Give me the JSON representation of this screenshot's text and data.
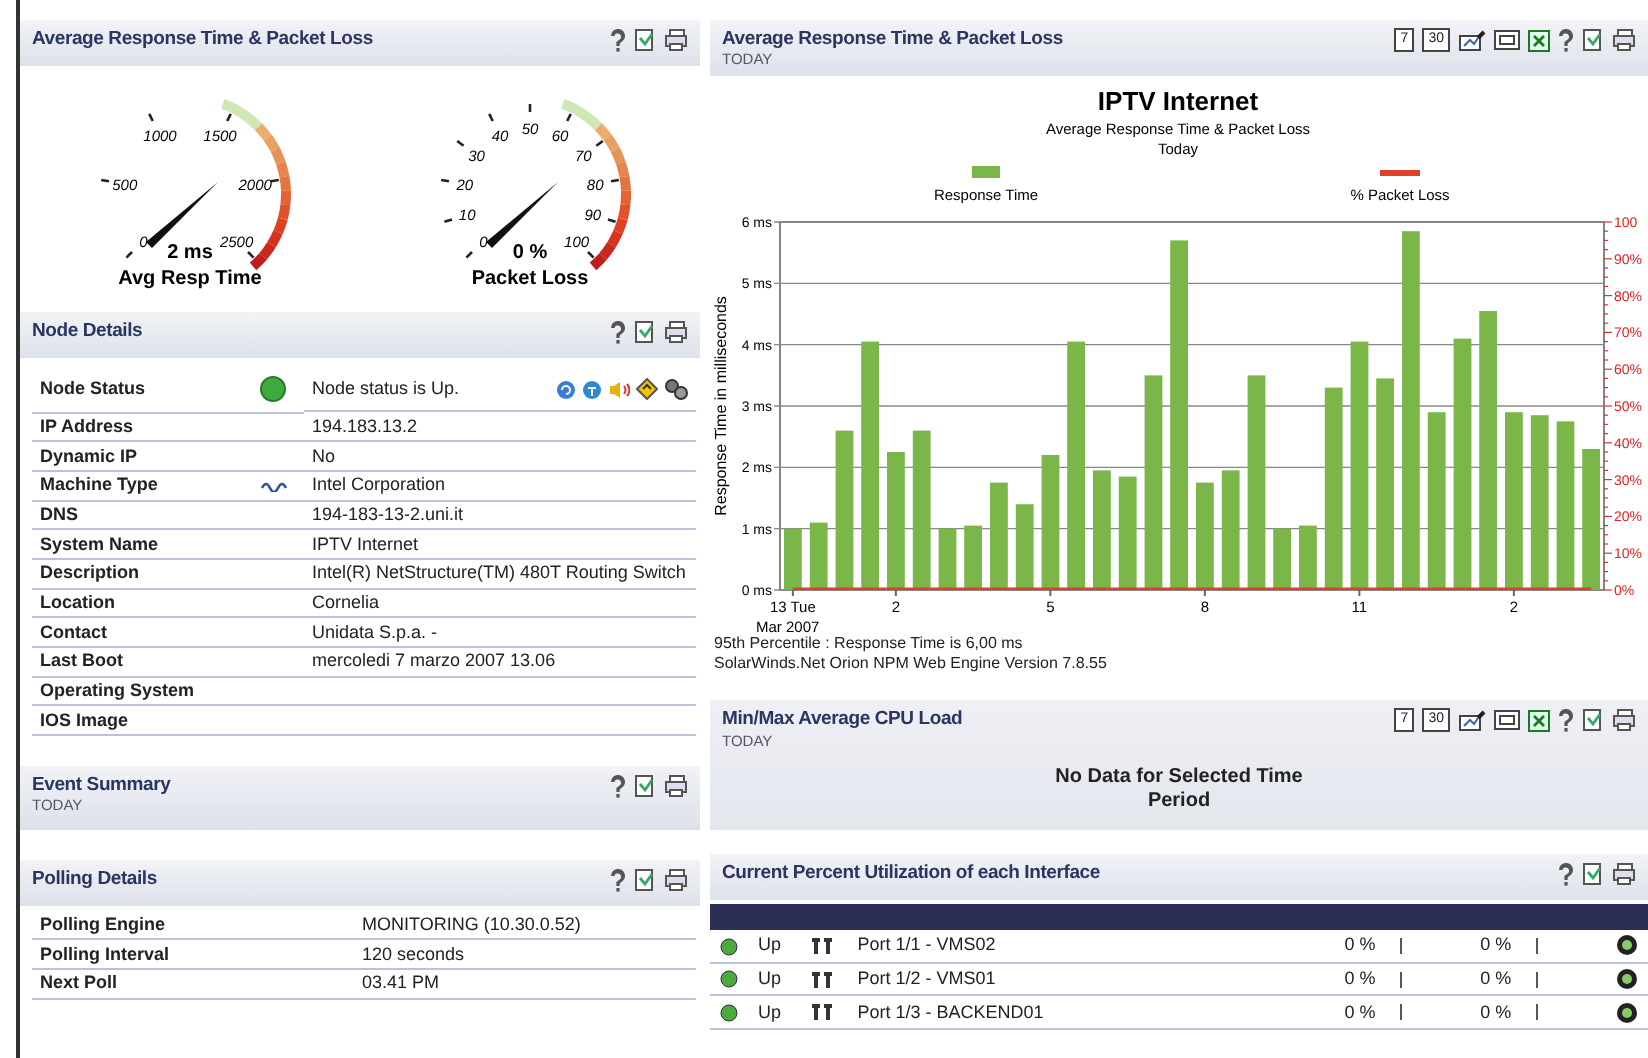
{
  "gauges_panel": {
    "title": "Average Response Time & Packet Loss",
    "gauges": [
      {
        "scale": [
          "0",
          "500",
          "1000",
          "1500",
          "2000",
          "2500"
        ],
        "reading": "2 ms",
        "label": "Avg Resp Time"
      },
      {
        "scale": [
          "0",
          "10",
          "20",
          "30",
          "40",
          "50",
          "60",
          "70",
          "80",
          "90",
          "100"
        ],
        "reading": "0 %",
        "label": "Packet Loss"
      }
    ]
  },
  "node_details": {
    "title": "Node Details",
    "rows": [
      {
        "label": "Node Status",
        "kind": "status",
        "value": "Node status is Up."
      },
      {
        "label": "IP Address",
        "value": "194.183.13.2"
      },
      {
        "label": "Dynamic IP",
        "value": "No"
      },
      {
        "label": "Machine Type",
        "kind": "vendor",
        "value": "Intel Corporation"
      },
      {
        "label": "DNS",
        "value": "194-183-13-2.uni.it"
      },
      {
        "label": "System Name",
        "value": "IPTV Internet"
      },
      {
        "label": "Description",
        "value": "Intel(R) NetStructure(TM) 480T Routing Switch"
      },
      {
        "label": "Location",
        "value": "Cornelia"
      },
      {
        "label": "Contact",
        "value": "Unidata S.p.a. -"
      },
      {
        "label": "Last Boot",
        "value": "mercoledi 7 marzo 2007 13.06"
      },
      {
        "label": "Operating System"
      },
      {
        "label": "IOS Image"
      }
    ]
  },
  "event_summary": {
    "title": "Event Summary",
    "period": "TODAY"
  },
  "polling_details": {
    "title": "Polling Details",
    "rows": [
      {
        "label": "Polling Engine",
        "value": "MONITORING (10.30.0.52)"
      },
      {
        "label": "Polling Interval",
        "value": "120 seconds"
      },
      {
        "label": "Next Poll",
        "value": "03.41 PM"
      }
    ]
  },
  "chart_panel": {
    "title": "Average Response Time & Packet Loss",
    "period": "TODAY",
    "toolbar": [
      "7",
      "30"
    ],
    "subtitle": "Average Response Time & Packet Loss",
    "range": "Today",
    "date_label": "Mar 2007",
    "notes": [
      "95th Percentile : Response Time is 6,00 ms",
      "SolarWinds.Net Orion NPM Web Engine  Version 7.8.55"
    ],
    "chart_data": {
      "type": "bar",
      "title": "IPTV Internet",
      "ylabel": "Response Time in milliseconds",
      "categories": [
        "13 Tue",
        null,
        null,
        null,
        "2",
        null,
        null,
        null,
        null,
        null,
        "5",
        null,
        null,
        null,
        null,
        null,
        "8",
        null,
        null,
        null,
        null,
        null,
        "11",
        null,
        null,
        null,
        null,
        null,
        "2",
        null,
        null,
        null
      ],
      "y2lim": [
        0,
        100
      ],
      "grid": true,
      "ylim": [
        0,
        6
      ],
      "yticks": [
        {
          "value": 0,
          "label": "0 ms"
        },
        {
          "value": 1,
          "label": "1 ms"
        },
        {
          "value": 2,
          "label": "2 ms"
        },
        {
          "value": 3,
          "label": "3 ms"
        },
        {
          "value": 4,
          "label": "4 ms"
        },
        {
          "value": 5,
          "label": "5 ms"
        },
        {
          "value": 6,
          "label": "6 ms"
        }
      ],
      "y2ticks": [
        {
          "value": 0,
          "label": "0%"
        },
        {
          "value": 10,
          "label": "10%"
        },
        {
          "value": 20,
          "label": "20%"
        },
        {
          "value": 30,
          "label": "30%"
        },
        {
          "value": 40,
          "label": "40%"
        },
        {
          "value": 50,
          "label": "50%"
        },
        {
          "value": 60,
          "label": "60%"
        },
        {
          "value": 70,
          "label": "70%"
        },
        {
          "value": 80,
          "label": "80%"
        },
        {
          "value": 90,
          "label": "90%"
        },
        {
          "value": 100,
          "label": "100"
        }
      ],
      "series": [
        {
          "name": "Response Time",
          "color": "#7ab648",
          "values": [
            1.0,
            1.1,
            2.6,
            4.05,
            2.25,
            2.6,
            1.0,
            1.05,
            1.75,
            1.4,
            2.2,
            4.05,
            1.95,
            1.85,
            3.5,
            5.7,
            1.75,
            1.95,
            3.5,
            1.0,
            1.05,
            3.3,
            4.05,
            3.45,
            5.85,
            2.9,
            4.1,
            4.55,
            2.9,
            2.85,
            2.75,
            2.3
          ]
        },
        {
          "name": "% Packet Loss",
          "color": "#e04028",
          "values": [
            0,
            0,
            0,
            0,
            0,
            0,
            0,
            0,
            0,
            0,
            0,
            0,
            0,
            0,
            0,
            0,
            0,
            0,
            0,
            0,
            0,
            0,
            0,
            0,
            0,
            0,
            0,
            0,
            0,
            0,
            0,
            0
          ]
        }
      ]
    }
  },
  "cpu_panel": {
    "title": "Min/Max Average CPU Load",
    "period": "TODAY",
    "toolbar": [
      "7",
      "30"
    ],
    "message": "No Data for Selected Time Period"
  },
  "interfaces_panel": {
    "title": "Current Percent Utilization of each Interface",
    "rows": [
      {
        "status": "Up",
        "name": "Port 1/1 - VMS02",
        "utilization": [
          {
            "text": "0 %",
            "level": 0
          },
          {
            "text": "0 %",
            "level": 0
          }
        ]
      },
      {
        "status": "Up",
        "name": "Port 1/2 - VMS01",
        "utilization": [
          {
            "text": "0 %",
            "level": 0
          },
          {
            "text": "0 %",
            "level": 0
          }
        ]
      },
      {
        "status": "Up",
        "name": "Port 1/3 - BACKEND01",
        "utilization": [
          {
            "text": "0 %",
            "level": 0
          },
          {
            "text": "0 %",
            "level": 0
          }
        ]
      }
    ]
  }
}
